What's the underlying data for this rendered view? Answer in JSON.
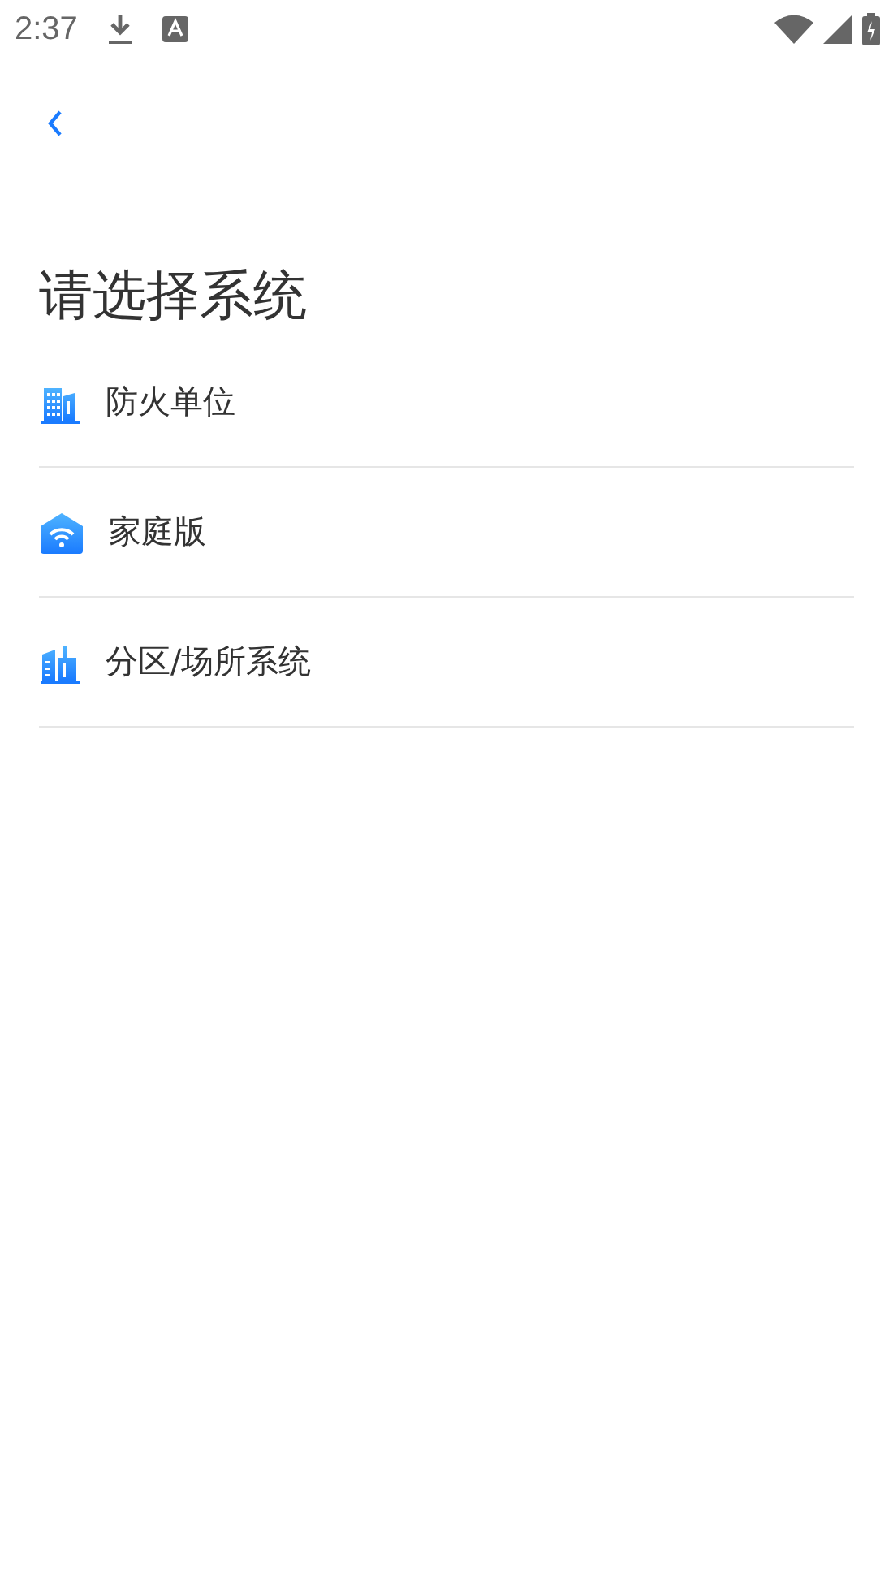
{
  "status_bar": {
    "time": "2:37"
  },
  "title": "请选择系统",
  "items": [
    {
      "kind": "building",
      "label": "防火单位"
    },
    {
      "kind": "home",
      "label": "家庭版"
    },
    {
      "kind": "district",
      "label": "分区/场所系统"
    }
  ]
}
